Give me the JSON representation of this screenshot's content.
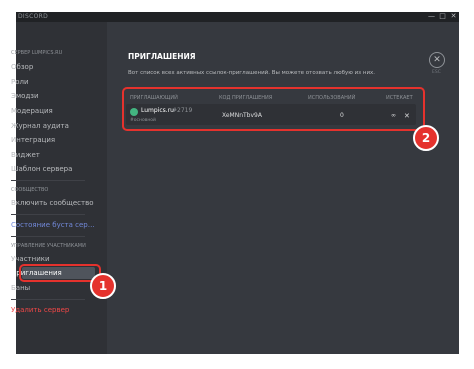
{
  "app": {
    "title": "DISCORD"
  },
  "window_controls": {
    "minimize": "—",
    "maximize": "□",
    "close": "✕"
  },
  "sidebar": {
    "server_header": "СЕРВЕР LUMPICS.RU",
    "items_server": [
      {
        "label": "Обзор"
      },
      {
        "label": "Роли"
      },
      {
        "label": "Эмодзи"
      },
      {
        "label": "Модерация"
      },
      {
        "label": "Журнал аудита"
      },
      {
        "label": "Интеграция"
      },
      {
        "label": "Виджет"
      },
      {
        "label": "Шаблон сервера"
      }
    ],
    "community_header": "СООБЩЕСТВО",
    "community_item": "Включить сообщество",
    "boost_item": "Состояние буста сер…",
    "members_header": "УПРАВЛЕНИЕ УЧАСТНИКАМИ",
    "members_items": [
      {
        "label": "Участники"
      },
      {
        "label": "Приглашения"
      },
      {
        "label": "Баны"
      }
    ],
    "delete_server": "Удалить сервер"
  },
  "main": {
    "title": "ПРИГЛАШЕНИЯ",
    "description": "Вот список всех активных ссылок-приглашений. Вы можете отозвать любую из них.",
    "close_label": "✕",
    "esc_label": "ESC",
    "table": {
      "headers": [
        "ПРИГЛАШАЮЩИЙ",
        "КОД ПРИГЛАШЕНИЯ",
        "ИСПОЛЬЗОВАНИЙ",
        "ИСТЕКАЕТ"
      ],
      "rows": [
        {
          "inviter": "Lumpics.ru",
          "tag": "#2719",
          "channel": "#основной",
          "code": "XeMNnTbv9A",
          "uses": "0",
          "expires": "∞",
          "revoke": "✕"
        }
      ]
    }
  },
  "callouts": {
    "one": "1",
    "two": "2"
  },
  "colors": {
    "accent": "#e5322d",
    "background": "#36393f",
    "sidebar": "#2f3136",
    "boost": "#7289da",
    "danger": "#f04747"
  }
}
